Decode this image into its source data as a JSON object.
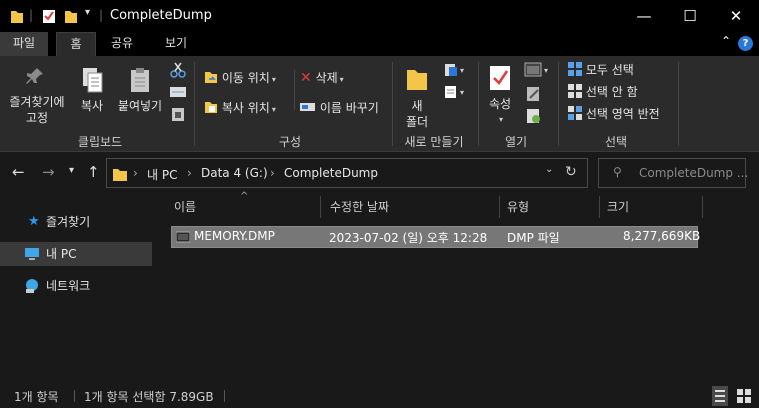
{
  "window": {
    "title": "CompleteDump",
    "minimize_glyph": "—",
    "maximize_glyph": "☐",
    "close_glyph": "✕"
  },
  "ribbon_tabs": [
    "파일",
    "홈",
    "공유",
    "보기"
  ],
  "ribbon": {
    "clipboard": {
      "pin_label_line1": "즐겨찾기에",
      "pin_label_line2": "고정",
      "copy_label": "복사",
      "paste_label": "붙여넣기",
      "group_label": "클립보드"
    },
    "organize": {
      "move_to_label": "이동 위치",
      "copy_to_label": "복사 위치",
      "delete_label": "삭제",
      "rename_label": "이름 바꾸기",
      "group_label": "구성"
    },
    "new": {
      "new_folder_line1": "새",
      "new_folder_line2": "폴더",
      "group_label": "새로 만들기"
    },
    "open": {
      "properties_label": "속성",
      "group_label": "열기"
    },
    "select": {
      "select_all_label": "모두 선택",
      "select_none_label": "선택 안 함",
      "invert_label": "선택 영역 반전",
      "group_label": "선택"
    }
  },
  "address": {
    "segments": [
      "내 PC",
      "Data 4 (G:)",
      "CompleteDump"
    ],
    "search_placeholder": "CompleteDump ..."
  },
  "nav_pane": {
    "items": [
      {
        "label": "즐겨찾기",
        "icon": "star-icon"
      },
      {
        "label": "내 PC",
        "icon": "computer-icon"
      },
      {
        "label": "네트워크",
        "icon": "network-icon"
      }
    ]
  },
  "columns": [
    "이름",
    "수정한 날짜",
    "유형",
    "크기"
  ],
  "files": [
    {
      "name": "MEMORY.DMP",
      "modified": "2023-07-02 (일) 오후 12:28",
      "type": "DMP 파일",
      "size": "8,277,669KB"
    }
  ],
  "status": {
    "count": "1개 항목",
    "selected": "1개 항목 선택함 7.89GB"
  },
  "colors": {
    "accent": "#2a78d8",
    "folder": "#f3c64a",
    "delete_red": "#e23b3b",
    "background": "#191919",
    "ribbon_bg": "#2b2b2b",
    "selection_bg": "#777777"
  }
}
